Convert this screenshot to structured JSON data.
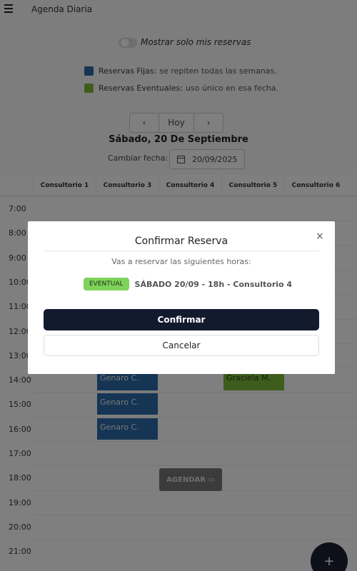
{
  "app": {
    "title": "Agenda Diaria"
  },
  "filters": {
    "toggle_label": "Mostrar solo mis reservas",
    "toggle_on": false
  },
  "legend": {
    "fixed": {
      "title": "Reservas Fijas:",
      "desc": "se repiten todas las semanas.",
      "color": "#2d6aa8"
    },
    "eventual": {
      "title": "Reservas Eventuales:",
      "desc": "uso único en esa fecha.",
      "color": "#7cba3a"
    }
  },
  "nav": {
    "prev": "‹",
    "today": "Hoy",
    "next": "›"
  },
  "date_title": "Sábado, 20 De Septiembre",
  "change_date": {
    "label": "Cambiar fecha:",
    "value": "20/09/2025"
  },
  "columns": [
    "Consultorio 1",
    "Consultorio 3",
    "Consultorio 4",
    "Consultorio 5",
    "Consultorio 6"
  ],
  "times": [
    "7:00",
    "8:00",
    "9:00",
    "10:00",
    "11:00",
    "12:00",
    "13:00",
    "14:00",
    "15:00",
    "16:00",
    "17:00",
    "18:00",
    "19:00",
    "20:00",
    "21:00"
  ],
  "slots": [
    {
      "name": "Genaro C.",
      "col": 1,
      "row": 7,
      "kind": "fixed"
    },
    {
      "name": "Genaro C.",
      "col": 1,
      "row": 8,
      "kind": "fixed"
    },
    {
      "name": "Genaro C.",
      "col": 1,
      "row": 9,
      "kind": "fixed"
    },
    {
      "name": "Graciela M.",
      "col": 3,
      "row": 7,
      "kind": "event"
    }
  ],
  "agendar_label": "AGENDAR",
  "fab_label": "+",
  "modal": {
    "title": "Confirmar Reserva",
    "close": "×",
    "subtitle": "Vas a reservar las siguientes horas:",
    "badge": "EVENTUAL",
    "booking": "SÁBADO 20/09 - 18h - Consultorio 4",
    "confirm": "Confirmar",
    "cancel": "Cancelar"
  }
}
